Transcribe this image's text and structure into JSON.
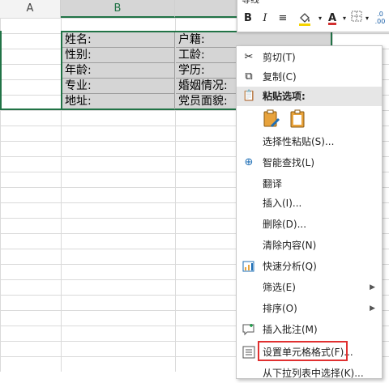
{
  "columns": {
    "a": "A",
    "b": "B"
  },
  "rows": [
    {
      "left": "姓名:",
      "right": "户籍:"
    },
    {
      "left": "性别:",
      "right": "工龄:"
    },
    {
      "left": "年龄:",
      "right": "学历:"
    },
    {
      "left": "专业:",
      "right": "婚姻情况:"
    },
    {
      "left": "地址:",
      "right": "党员面貌:"
    }
  ],
  "mini_toolbar": {
    "font": "等线",
    "bold": "B",
    "italic": "I",
    "align": "≡",
    "font_color": "A",
    "increase_decimal": ".0\n.00"
  },
  "context_menu": {
    "cut": "剪切(T)",
    "copy": "复制(C)",
    "paste_options": "粘贴选项:",
    "paste_special": "选择性粘贴(S)...",
    "smart_lookup": "智能查找(L)",
    "translate": "翻译",
    "insert": "插入(I)...",
    "delete": "删除(D)...",
    "clear_contents": "清除内容(N)",
    "quick_analysis": "快速分析(Q)",
    "filter": "筛选(E)",
    "sort": "排序(O)",
    "insert_comment": "插入批注(M)",
    "format_cells": "设置单元格格式(F)...",
    "pick_from_list": "从下拉列表中选择(K)..."
  },
  "colors": {
    "accent": "#217346",
    "highlight_border": "#e03030",
    "font_color_bar": "#d32f2f"
  }
}
